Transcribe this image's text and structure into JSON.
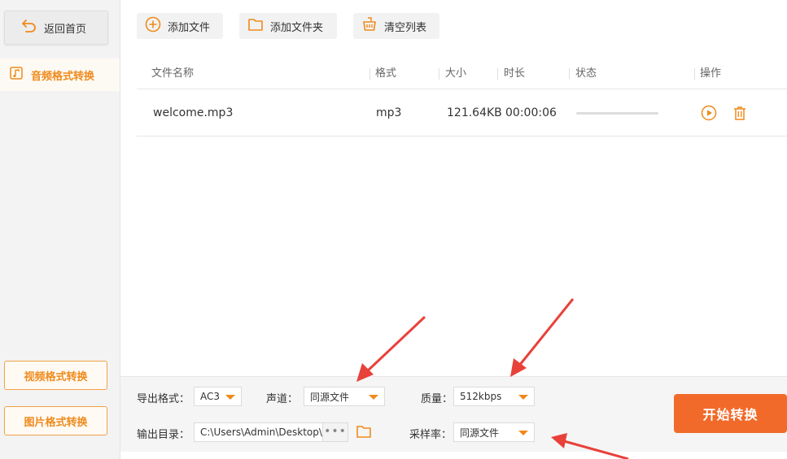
{
  "sidebar": {
    "home_label": "返回首页",
    "active_item": "音频格式转换",
    "video_btn": "视频格式转换",
    "image_btn": "图片格式转换"
  },
  "toolbar": {
    "add_file": "添加文件",
    "add_folder": "添加文件夹",
    "clear_list": "清空列表"
  },
  "table": {
    "columns": {
      "name": "文件名称",
      "format": "格式",
      "size": "大小",
      "duration": "时长",
      "status": "状态",
      "actions": "操作"
    },
    "rows": [
      {
        "name": "welcome.mp3",
        "format": "mp3",
        "size": "121.64KB",
        "duration": "00:00:06",
        "progress": 0
      }
    ]
  },
  "settings": {
    "export_format_label": "导出格式：",
    "export_format_value": "AC3",
    "channel_label": "声道：",
    "channel_value": "同源文件",
    "quality_label": "质量：",
    "quality_value": "512kbps",
    "output_dir_label": "输出目录：",
    "output_dir_value": "C:\\Users\\Admin\\Desktop\\",
    "browse_dots": "•••",
    "sample_rate_label": "采样率：",
    "sample_rate_value": "同源文件"
  },
  "start_button": "开始转换",
  "colors": {
    "accent": "#f08a1c",
    "start": "#f26a2a",
    "arrow": "#e8413a"
  }
}
